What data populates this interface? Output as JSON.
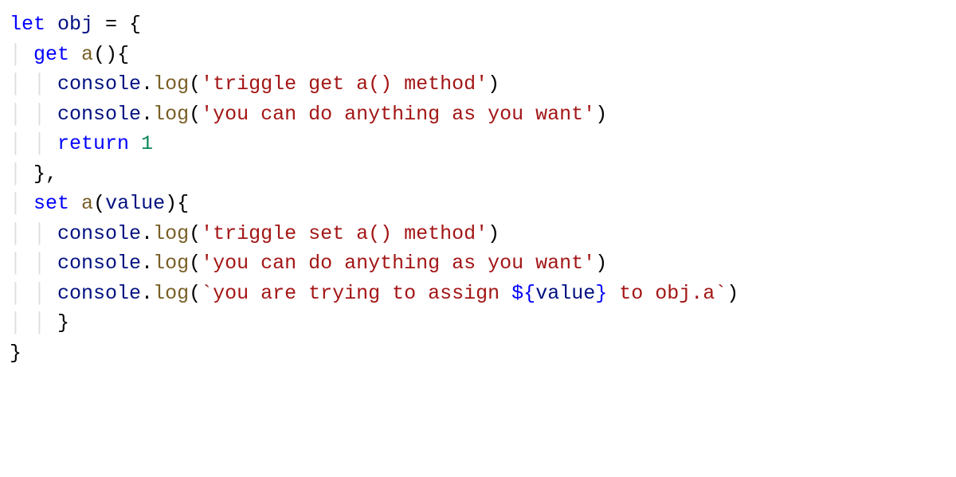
{
  "code": {
    "l1": {
      "let": "let",
      "obj": "obj",
      "eq": " = {",
      "sp": " "
    },
    "l2": {
      "guide": "│ ",
      "get": "get",
      "sp": " ",
      "a": "a",
      "paren": "(){"
    },
    "l3": {
      "guide": "│ │ ",
      "console": "console",
      "dot": ".",
      "log": "log",
      "open": "(",
      "str": "'triggle get a() method'",
      "close": ")"
    },
    "l4": {
      "guide": "│ │ ",
      "console": "console",
      "dot": ".",
      "log": "log",
      "open": "(",
      "str": "'you can do anything as you want'",
      "close": ")"
    },
    "l5": {
      "guide": "│ │ ",
      "return": "return",
      "sp": " ",
      "num": "1"
    },
    "l6": {
      "guide": "│ ",
      "brace": "},"
    },
    "l7": {
      "guide": "│ ",
      "set": "set",
      "sp": " ",
      "a": "a",
      "paren": "(",
      "value": "value",
      "close": "){"
    },
    "l8": {
      "guide": "│ │ ",
      "console": "console",
      "dot": ".",
      "log": "log",
      "open": "(",
      "str": "'triggle set a() method'",
      "close": ")"
    },
    "l9": {
      "guide": "│ │ ",
      "console": "console",
      "dot": ".",
      "log": "log",
      "open": "(",
      "str": "'you can do anything as you want'",
      "close": ")"
    },
    "l10": {
      "guide": "│ │ ",
      "console": "console",
      "dot": ".",
      "log": "log",
      "open": "(",
      "tick1": "`",
      "str1": "you are trying to assign ",
      "interp_open": "${",
      "value": "value",
      "interp_close": "}",
      "str2": " to obj.a",
      "tick2": "`",
      "close": ")"
    },
    "l11": {
      "guide": "│ │ ",
      "brace": "}"
    },
    "l12": {
      "guide": "",
      "brace": "}"
    }
  }
}
